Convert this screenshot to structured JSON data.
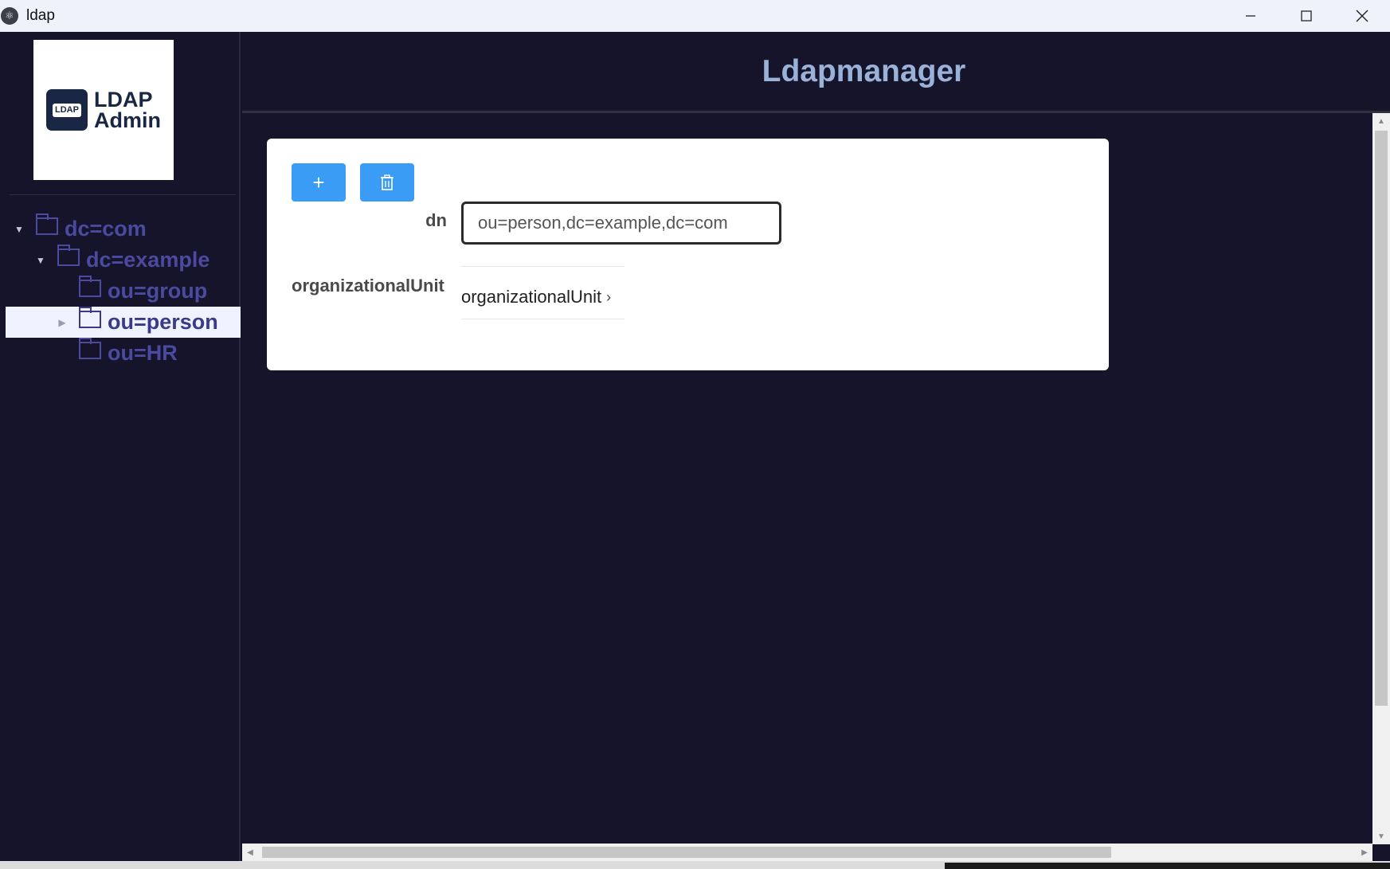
{
  "window": {
    "title": "ldap",
    "controls": [
      "minimize",
      "maximize",
      "close"
    ]
  },
  "sidebar": {
    "logo": {
      "badge": "LDAP",
      "line1": "LDAP",
      "line2": "Admin"
    },
    "tree": [
      {
        "label": "dc=com",
        "level": 0,
        "expanded": true,
        "selected": false
      },
      {
        "label": "dc=example",
        "level": 1,
        "expanded": true,
        "selected": false
      },
      {
        "label": "ou=group",
        "level": 2,
        "expanded": false,
        "selected": false
      },
      {
        "label": "ou=person",
        "level": 2,
        "expanded": false,
        "selected": true
      },
      {
        "label": "ou=HR",
        "level": 2,
        "expanded": false,
        "selected": false
      }
    ]
  },
  "header": {
    "title": "Ldapmanager"
  },
  "form": {
    "add_button": "+",
    "delete_button_icon": "trash-icon",
    "dn_label": "dn",
    "dn_value": "ou=person,dc=example,dc=com",
    "ou_label": "organizationalUnit",
    "ou_value": "organizationalUnit"
  },
  "colors": {
    "background": "#15142b",
    "accent_button": "#3a9cf5",
    "tree_text": "#4a4a9e",
    "header_title": "#9bb2d8"
  }
}
